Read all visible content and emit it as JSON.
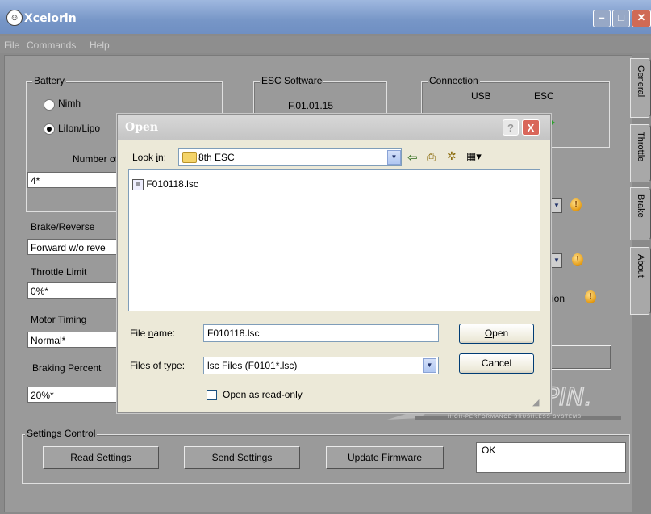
{
  "app": {
    "title": "Xcelorin",
    "menu": [
      "File",
      "Commands",
      "Help"
    ]
  },
  "battery": {
    "group_label": "Battery",
    "options": [
      "Nimh",
      "LiIon/Lipo"
    ],
    "selected": "LiIon/Lipo",
    "cells_label": "Number of C",
    "cells_value": "4*"
  },
  "esc_software": {
    "group_label": "ESC Software",
    "version": "F.01.01.15"
  },
  "connection": {
    "group_label": "Connection",
    "usb_label": "USB",
    "esc_label": "ESC"
  },
  "settings": {
    "brake_reverse_label": "Brake/Reverse",
    "brake_reverse_value": "Forward w/o reve",
    "throttle_limit_label": "Throttle Limit",
    "throttle_limit_value": "0%*",
    "motor_timing_label": "Motor Timing",
    "motor_timing_value": "Normal*",
    "braking_percent_label": "Braking Percent",
    "braking_percent_value": "20%*",
    "partial_label": "ion"
  },
  "tabs": [
    "General",
    "Throttle",
    "Brake",
    "About"
  ],
  "settings_control": {
    "group_label": "Settings Control",
    "read_button": "Read Settings",
    "send_button": "Send Settings",
    "update_button": "Update Firmware",
    "status_text": "OK"
  },
  "logo": {
    "tagline": "HIGH-PERFORMANCE BRUSHLESS SYSTEMS"
  },
  "open_dialog": {
    "title": "Open",
    "help_button": "?",
    "close_button": "X",
    "look_in_label_pre": "Look ",
    "look_in_label_u": "i",
    "look_in_label_post": "n:",
    "look_in_value": "8th ESC",
    "files": [
      "F010118.lsc"
    ],
    "file_name_label_pre": "File ",
    "file_name_label_u": "n",
    "file_name_label_post": "ame:",
    "file_name_value": "F010118.lsc",
    "file_type_label_pre": "Files of ",
    "file_type_label_u": "t",
    "file_type_label_post": "ype:",
    "file_type_value": "lsc Files (F0101*.lsc)",
    "open_button_u": "O",
    "open_button_rest": "pen",
    "cancel_button": "Cancel",
    "read_only_pre": "Open as ",
    "read_only_u": "r",
    "read_only_post": "ead-only",
    "read_only_checked": false
  }
}
